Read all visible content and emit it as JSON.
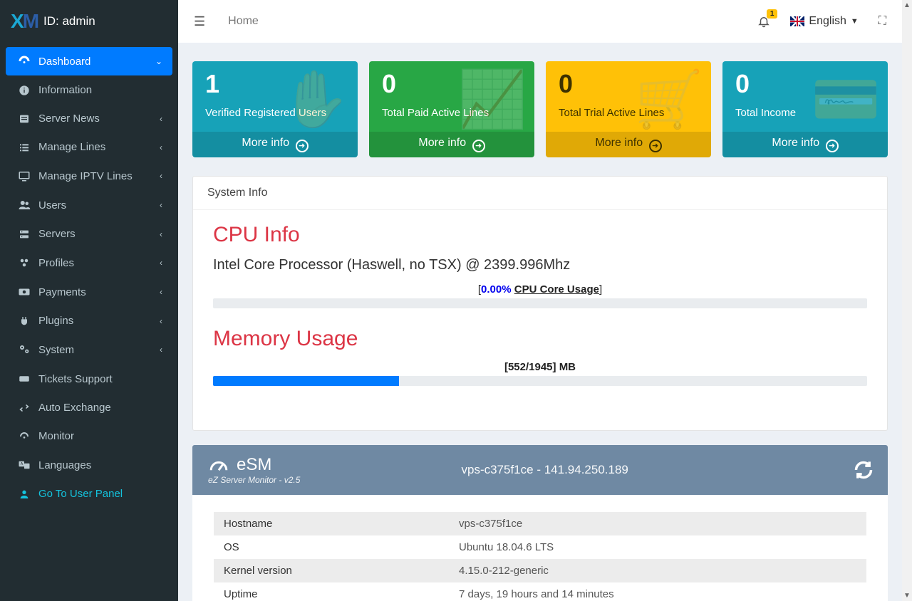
{
  "header": {
    "id_label": "ID: admin"
  },
  "sidebar": {
    "items": [
      {
        "label": "Dashboard"
      },
      {
        "label": "Information"
      },
      {
        "label": "Server News"
      },
      {
        "label": "Manage Lines"
      },
      {
        "label": "Manage IPTV Lines"
      },
      {
        "label": "Users"
      },
      {
        "label": "Servers"
      },
      {
        "label": "Profiles"
      },
      {
        "label": "Payments"
      },
      {
        "label": "Plugins"
      },
      {
        "label": "System"
      },
      {
        "label": "Tickets Support"
      },
      {
        "label": "Auto Exchange"
      },
      {
        "label": "Monitor"
      },
      {
        "label": "Languages"
      },
      {
        "label": "Go To User Panel"
      }
    ]
  },
  "topbar": {
    "breadcrumb": "Home",
    "notification_count": "1",
    "language": "English"
  },
  "stats": [
    {
      "value": "1",
      "label": "Verified Registered Users",
      "more": "More info"
    },
    {
      "value": "0",
      "label": "Total Paid Active Lines",
      "more": "More info"
    },
    {
      "value": "0",
      "label": "Total Trial Active Lines",
      "more": "More info"
    },
    {
      "value": "0",
      "label": "Total Income",
      "more": "More info"
    }
  ],
  "system_info": {
    "card_title": "System Info",
    "cpu_title": "CPU Info",
    "cpu_name": "Intel Core Processor (Haswell, no TSX) @ 2399.996Mhz",
    "cpu_pct": "0.00%",
    "cpu_label": "CPU Core Usage",
    "mem_title": "Memory Usage",
    "mem_label": "[552/1945] MB",
    "mem_fill_pct": 28.4
  },
  "esm": {
    "title": "eSM",
    "subtitle": "eZ Server Monitor - v2.5",
    "host_line": "vps-c375f1ce - 141.94.250.189",
    "rows": [
      {
        "k": "Hostname",
        "v": "vps-c375f1ce"
      },
      {
        "k": "OS",
        "v": "Ubuntu 18.04.6 LTS"
      },
      {
        "k": "Kernel version",
        "v": "4.15.0-212-generic"
      },
      {
        "k": "Uptime",
        "v": "7 days, 19 hours and 14 minutes"
      }
    ]
  }
}
